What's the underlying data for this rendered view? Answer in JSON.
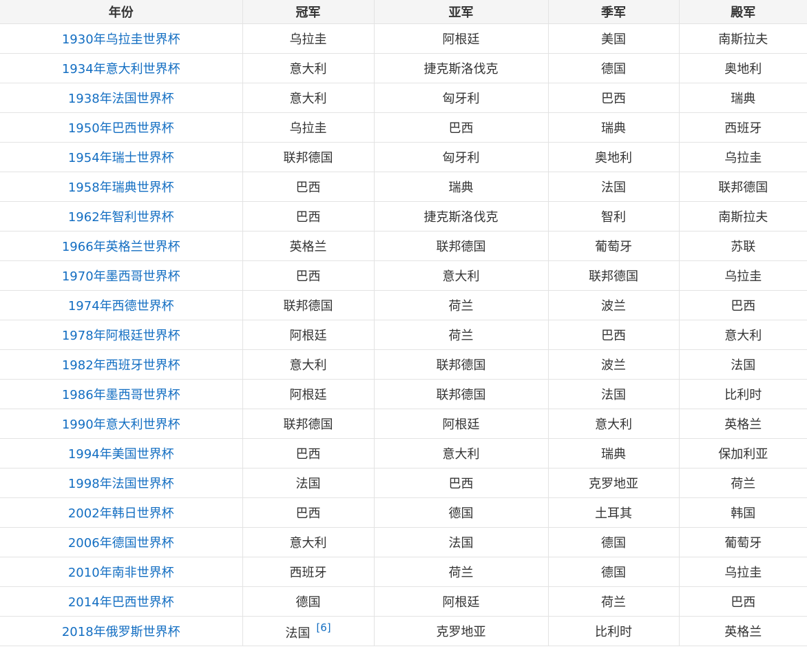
{
  "table": {
    "headers": [
      "年份",
      "冠军",
      "亚军",
      "季军",
      "殿军"
    ],
    "rows": [
      {
        "year": "1930年乌拉圭世界杯",
        "champion": "乌拉圭",
        "runner_up": "阿根廷",
        "third": "美国",
        "fourth": "南斯拉夫"
      },
      {
        "year": "1934年意大利世界杯",
        "champion": "意大利",
        "runner_up": "捷克斯洛伐克",
        "third": "德国",
        "fourth": "奥地利"
      },
      {
        "year": "1938年法国世界杯",
        "champion": "意大利",
        "runner_up": "匈牙利",
        "third": "巴西",
        "fourth": "瑞典"
      },
      {
        "year": "1950年巴西世界杯",
        "champion": "乌拉圭",
        "runner_up": "巴西",
        "third": "瑞典",
        "fourth": "西班牙"
      },
      {
        "year": "1954年瑞士世界杯",
        "champion": "联邦德国",
        "runner_up": "匈牙利",
        "third": "奥地利",
        "fourth": "乌拉圭"
      },
      {
        "year": "1958年瑞典世界杯",
        "champion": "巴西",
        "runner_up": "瑞典",
        "third": "法国",
        "fourth": "联邦德国"
      },
      {
        "year": "1962年智利世界杯",
        "champion": "巴西",
        "runner_up": "捷克斯洛伐克",
        "third": "智利",
        "fourth": "南斯拉夫"
      },
      {
        "year": "1966年英格兰世界杯",
        "champion": "英格兰",
        "runner_up": "联邦德国",
        "third": "葡萄牙",
        "fourth": "苏联"
      },
      {
        "year": "1970年墨西哥世界杯",
        "champion": "巴西",
        "runner_up": "意大利",
        "third": "联邦德国",
        "fourth": "乌拉圭"
      },
      {
        "year": "1974年西德世界杯",
        "champion": "联邦德国",
        "runner_up": "荷兰",
        "third": "波兰",
        "fourth": "巴西"
      },
      {
        "year": "1978年阿根廷世界杯",
        "champion": "阿根廷",
        "runner_up": "荷兰",
        "third": "巴西",
        "fourth": "意大利"
      },
      {
        "year": "1982年西班牙世界杯",
        "champion": "意大利",
        "runner_up": "联邦德国",
        "third": "波兰",
        "fourth": "法国"
      },
      {
        "year": "1986年墨西哥世界杯",
        "champion": "阿根廷",
        "runner_up": "联邦德国",
        "third": "法国",
        "fourth": "比利时"
      },
      {
        "year": "1990年意大利世界杯",
        "champion": "联邦德国",
        "runner_up": "阿根廷",
        "third": "意大利",
        "fourth": "英格兰"
      },
      {
        "year": "1994年美国世界杯",
        "champion": "巴西",
        "runner_up": "意大利",
        "third": "瑞典",
        "fourth": "保加利亚"
      },
      {
        "year": "1998年法国世界杯",
        "champion": "法国",
        "runner_up": "巴西",
        "third": "克罗地亚",
        "fourth": "荷兰"
      },
      {
        "year": "2002年韩日世界杯",
        "champion": "巴西",
        "runner_up": "德国",
        "third": "土耳其",
        "fourth": "韩国"
      },
      {
        "year": "2006年德国世界杯",
        "champion": "意大利",
        "runner_up": "法国",
        "third": "德国",
        "fourth": "葡萄牙"
      },
      {
        "year": "2010年南非世界杯",
        "champion": "西班牙",
        "runner_up": "荷兰",
        "third": "德国",
        "fourth": "乌拉圭"
      },
      {
        "year": "2014年巴西世界杯",
        "champion": "德国",
        "runner_up": "阿根廷",
        "third": "荷兰",
        "fourth": "巴西"
      },
      {
        "year": "2018年俄罗斯世界杯",
        "champion": "法国",
        "champion_ref": "[6]",
        "runner_up": "克罗地亚",
        "third": "比利时",
        "fourth": "英格兰"
      }
    ]
  },
  "colors": {
    "link": "#136ec2",
    "header_bg": "#f5f5f5",
    "border": "#e3e3e3",
    "text": "#333333"
  }
}
